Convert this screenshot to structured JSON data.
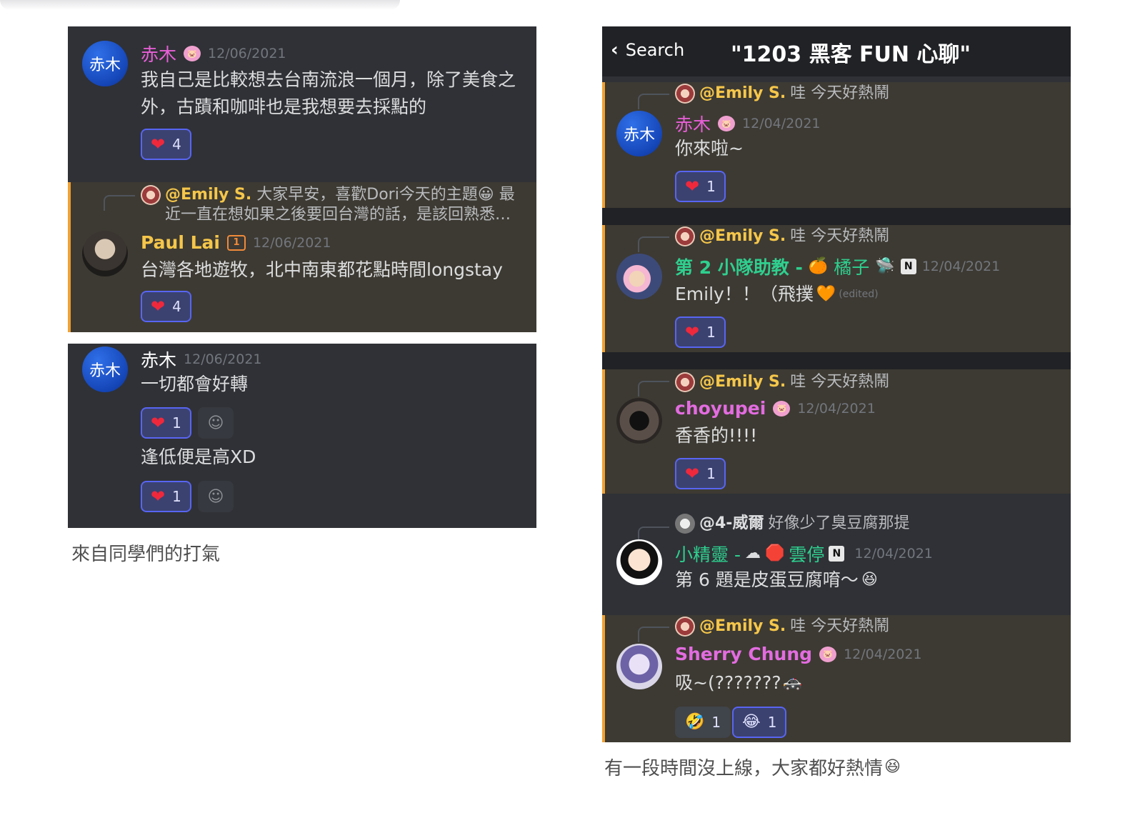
{
  "left": {
    "panel1": {
      "msg1": {
        "avatar_text": "赤木",
        "username": "赤木",
        "timestamp": "12/06/2021",
        "text": "我自己是比較想去台南流浪一個月，除了美食之外，古蹟和咖啡也是我想要去採點的",
        "reaction_count": "4"
      },
      "msg2": {
        "reply_mention": "@Emily S.",
        "reply_text": "大家早安，喜歡Dori今天的主題😀 最近一直在想如果之後要回台灣的話，是該回熟悉…",
        "username": "Paul Lai",
        "timestamp": "12/06/2021",
        "text": "台灣各地遊牧，北中南東都花點時間longstay",
        "reaction_count": "4"
      }
    },
    "panel2": {
      "avatar_text": "赤木",
      "username": "赤木",
      "timestamp": "12/06/2021",
      "text1": "一切都會好轉",
      "reaction1_count": "1",
      "text2": "逢低便是高XD",
      "reaction2_count": "1"
    },
    "caption": "來自同學們的打氣"
  },
  "right": {
    "header": {
      "back_label": "Search",
      "title": "\"1203 黑客 FUN 心聊\""
    },
    "messages": [
      {
        "reply_mention": "@Emily S.",
        "reply_text": "哇 今天好熱鬧",
        "avatar_text": "赤木",
        "username": "赤木",
        "timestamp": "12/04/2021",
        "text": "你來啦~",
        "reaction_count": "1"
      },
      {
        "reply_mention": "@Emily S.",
        "reply_text": "哇 今天好熱鬧",
        "username_a": "第 2 小隊助教 -",
        "username_b": "橘子",
        "timestamp": "12/04/2021",
        "text": "Emily！！（飛撲",
        "edited": "(edited)",
        "reaction_count": "1"
      },
      {
        "reply_mention": "@Emily S.",
        "reply_text": "哇 今天好熱鬧",
        "username": "choyupei",
        "timestamp": "12/04/2021",
        "text": "香香的!!!!",
        "reaction_count": "1"
      },
      {
        "reply_mention": "@4-威爾",
        "reply_text": "好像少了臭豆腐那提",
        "username_a": "小精靈 -",
        "username_b": "雲停",
        "timestamp": "12/04/2021",
        "text": "第 6 題是皮蛋豆腐唷～"
      },
      {
        "reply_mention": "@Emily S.",
        "reply_text": "哇 今天好熱鬧",
        "username": "Sherry Chung",
        "timestamp": "12/04/2021",
        "text": "吸~(???????",
        "reaction1_count": "1",
        "reaction2_count": "1"
      }
    ],
    "caption": "有一段時間沒上線，大家都好熱情"
  },
  "colors": {
    "highlight_bar": "#f0a032",
    "reaction_border": "#5865f2",
    "panel_bg": "#2f3136"
  }
}
